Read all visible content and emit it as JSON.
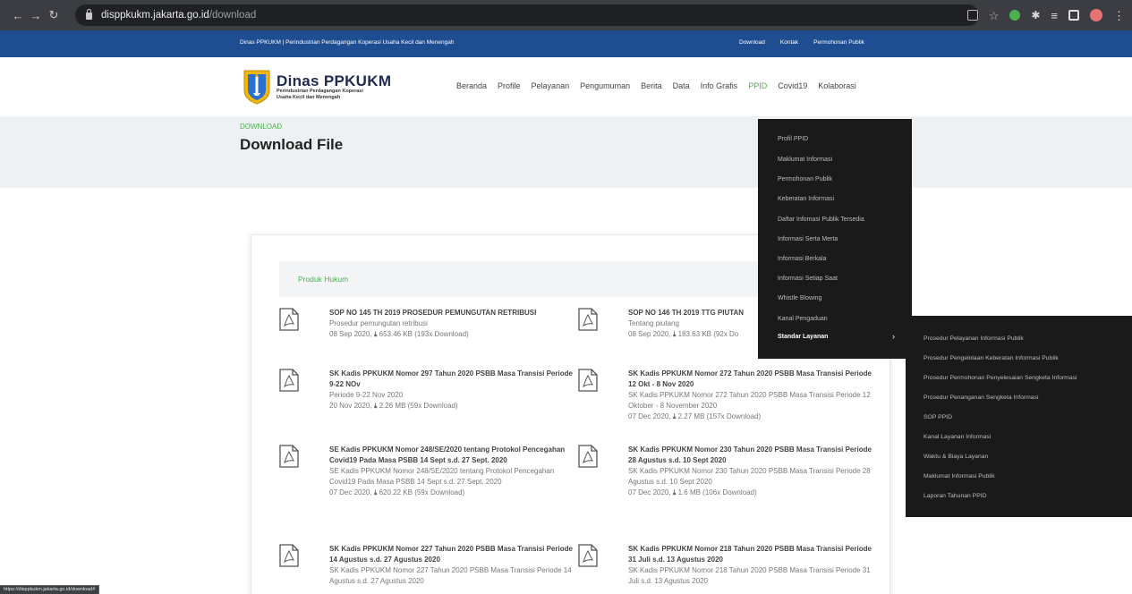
{
  "browser": {
    "url_host": "disppkukm.jakarta.go.id",
    "url_path": "/download",
    "status_url": "https://disppkukm.jakarta.go.id/download#"
  },
  "topbar": {
    "agency": "Dinas PPKUKM | Perindustrian Perdagangan Koperasi Usaha Kecil dan Menengah",
    "links": [
      "Download",
      "Kontak",
      "Permohonan Publik"
    ]
  },
  "logo": {
    "title": "Dinas PPKUKM",
    "sub1": "Perindustrian Perdagangan Koperasi",
    "sub2": "Usaha Kecil dan Menengah"
  },
  "nav": {
    "items": [
      "Beranda",
      "Profile",
      "Pelayanan",
      "Pengumuman",
      "Berita",
      "Data",
      "Info Grafis",
      "PPID",
      "Covid19",
      "Kolaborasi"
    ],
    "active": "PPID"
  },
  "page": {
    "breadcrumb": "DOWNLOAD",
    "title": "Download File",
    "section": "Produk Hukum"
  },
  "docs": [
    {
      "title": "SOP NO 145 TH 2019 PROSEDUR PEMUNGUTAN RETRIBUSI",
      "desc": "Prosedur pemungutan retribusi",
      "date": "08 Sep 2020,",
      "size": "653.46 KB (193x Download)"
    },
    {
      "title": "SOP NO 146 TH 2019 TTG PIUTAN",
      "desc": "Tentang piutang",
      "date": "08 Sep 2020,",
      "size": "183.63 KB (92x Do"
    },
    {
      "title": "SK Kadis PPKUKM Nomor 297 Tahun 2020 PSBB Masa Transisi Periode 9-22 NOv",
      "desc": "Periode 9-22 Nov 2020",
      "date": "20 Nov 2020,",
      "size": "2.26 MB (59x Download)"
    },
    {
      "title": "SK Kadis PPKUKM Nomor 272 Tahun 2020 PSBB Masa Transisi Periode 12 Okt - 8 Nov 2020",
      "desc": "SK Kadis PPKUKM Nomor 272 Tahun 2020 PSBB Masa Transisi Periode 12 Oktober - 8 November 2020",
      "date": "07 Dec 2020,",
      "size": "2.27 MB (157x Download)"
    },
    {
      "title": "SE Kadis PPKUKM Nomor 248/SE/2020 tentang Protokol Pencegahan Covid19 Pada Masa PSBB 14 Sept s.d. 27 Sept. 2020",
      "desc": "SE Kadis PPKUKM Nomor 248/SE/2020 tentang Protokol Pencegahan Covid19 Pada Masa PSBB 14 Sept s.d. 27 Sept. 2020",
      "date": "07 Dec 2020,",
      "size": "620.22 KB (59x Download)"
    },
    {
      "title": "SK Kadis PPKUKM Nomor 230 Tahun 2020 PSBB Masa Transisi Periode 28 Agustus s.d. 10 Sept 2020",
      "desc": "SK Kadis PPKUKM Nomor 230 Tahun 2020 PSBB Masa Transisi Periode 28 Agustus s.d. 10 Sept 2020",
      "date": "07 Dec 2020,",
      "size": "1.6 MB (106x Download)"
    },
    {
      "title": "SK Kadis PPKUKM Nomor 227 Tahun 2020 PSBB Masa Transisi Periode 14 Agustus s.d. 27 Agustus 2020",
      "desc": "SK Kadis PPKUKM Nomor 227 Tahun 2020 PSBB Masa Transisi Periode 14 Agustus s.d. 27 Agustus 2020",
      "date": "",
      "size": ""
    },
    {
      "title": "SK Kadis PPKUKM Nomor 218 Tahun 2020 PSBB Masa Transisi Periode 31 Juli s.d. 13 Agustus 2020",
      "desc": "SK Kadis PPKUKM Nomor 218 Tahun 2020 PSBB Masa Transisi Periode 31 Juli s.d. 13 Agustus 2020",
      "date": "",
      "size": ""
    }
  ],
  "ppid_menu": [
    "Profil PPID",
    "Maklumat Informasi",
    "Permohonan Publik",
    "Keberatan Informasi",
    "Daftar Infomasi Publik Tersedia",
    "Informasi Serta Merta",
    "Informasi Berkala",
    "Informasi Setiap Saat",
    "Whistle Blowing",
    "Kanal Pengaduan",
    "Standar Layanan"
  ],
  "standar_menu": [
    "Prosedur Pelayanan Informasi Publik",
    "Prosedur Pengelolaan Keberatan Informasi Publik",
    "Prosedur Permohonan Penyelesaian Sengketa Informasi",
    "Prosedur Penanganan Sengketa Informasi",
    "SOP PPID",
    "Kanal Layanan Informasi",
    "Waktu & Biaya Layanan",
    "Maklumat Informasi Publik",
    "Laporan Tahunan PPID"
  ],
  "colors": {
    "topbar": "#1e4d92",
    "accent": "#4caf50",
    "dropdown": "#1a1a1a"
  }
}
